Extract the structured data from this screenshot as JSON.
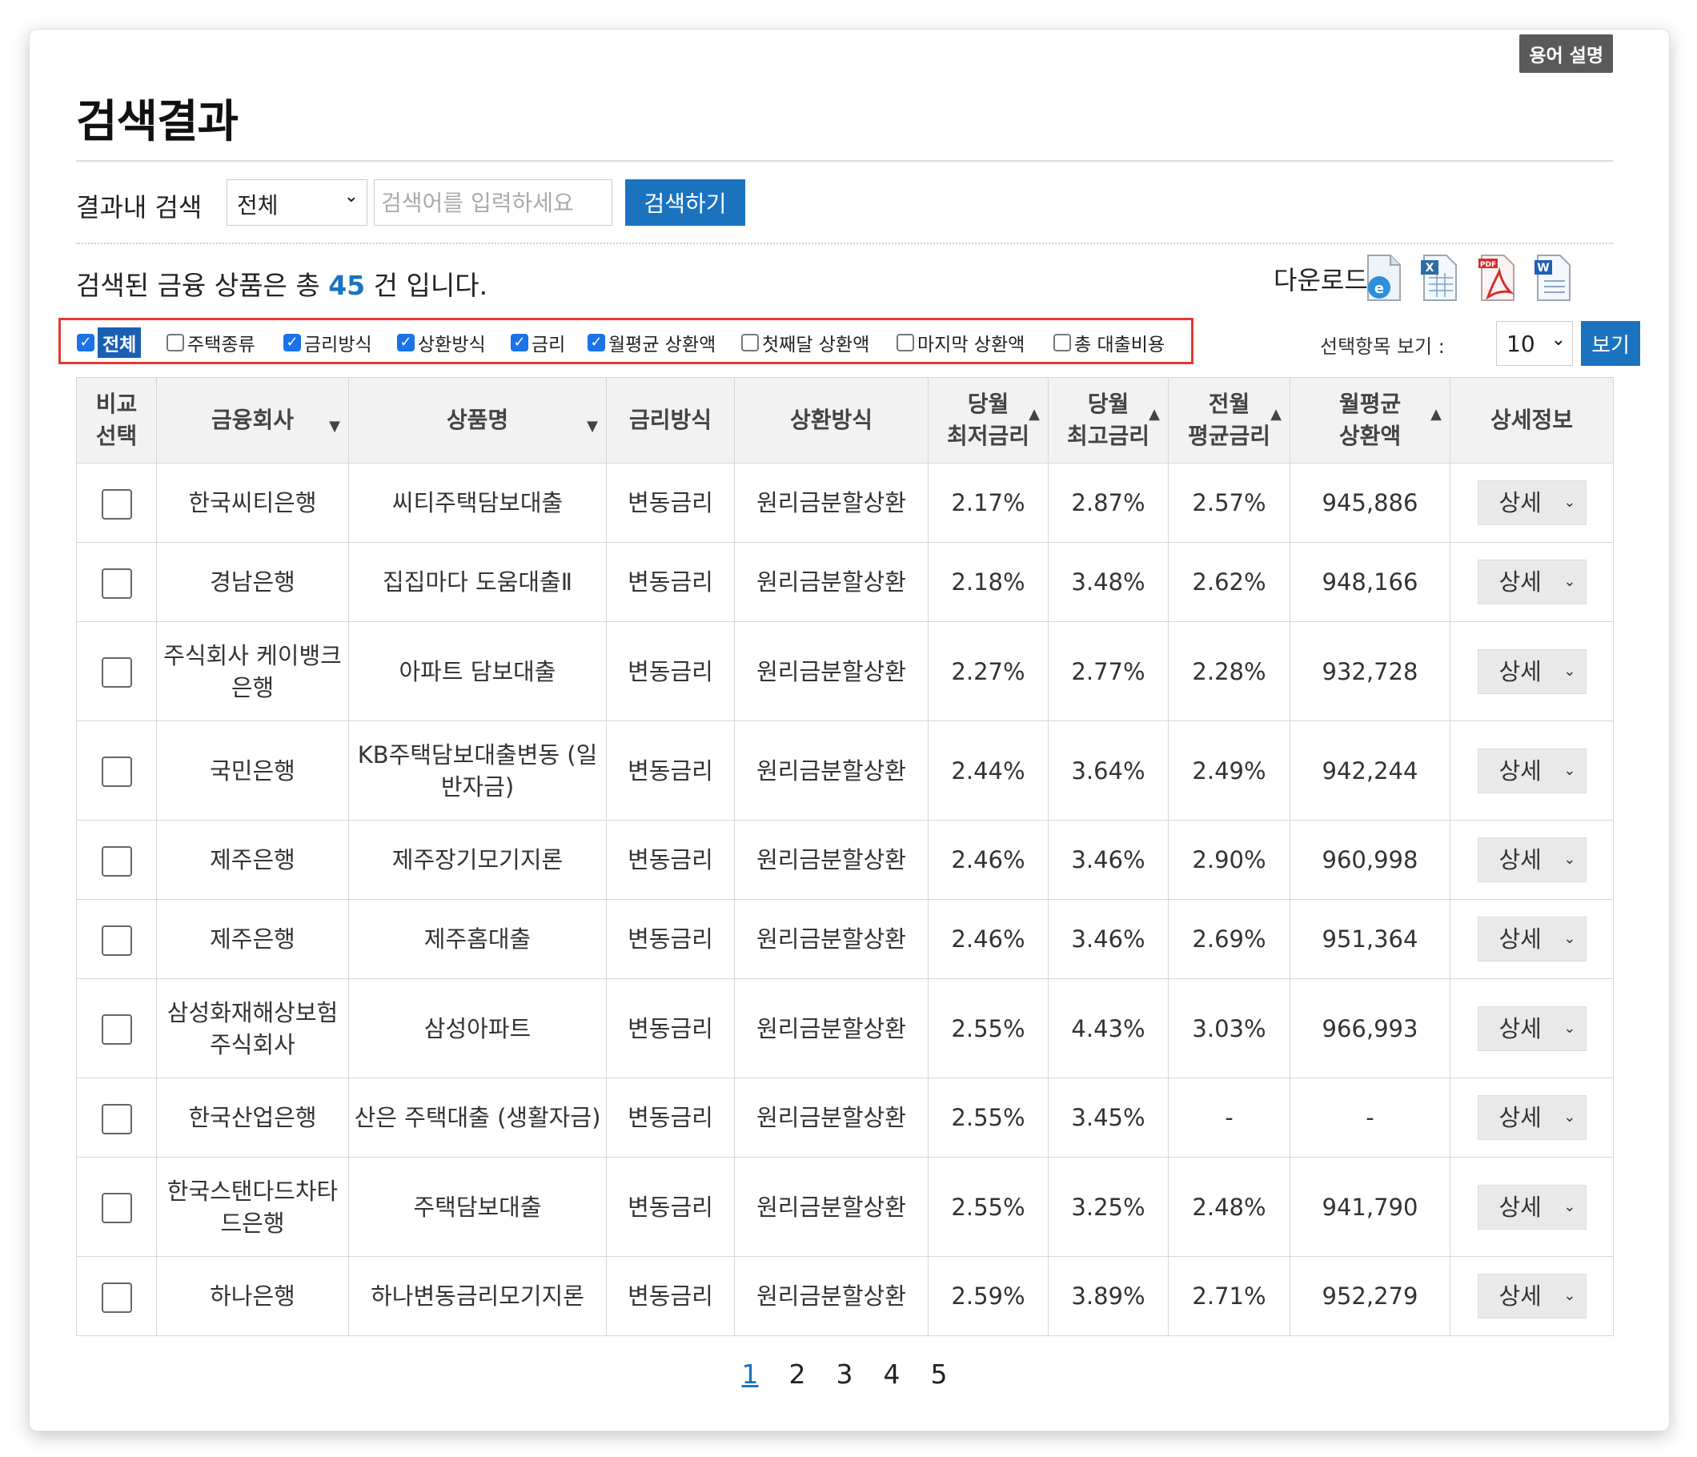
{
  "header": {
    "glossary_button": "용어 설명",
    "title": "검색결과"
  },
  "search": {
    "label": "결과내 검색",
    "scope_value": "전체",
    "placeholder": "검색어를 입력하세요",
    "value": "",
    "button": "검색하기"
  },
  "summary": {
    "prefix": "검색된 금융 상품은 총",
    "count": "45",
    "suffix": "건 입니다."
  },
  "download": {
    "label": "다운로드",
    "formats": [
      "hwp-icon",
      "excel-icon",
      "pdf-icon",
      "word-icon"
    ]
  },
  "column_filters": [
    {
      "label": "전체",
      "checked": true
    },
    {
      "label": "주택종류",
      "checked": false
    },
    {
      "label": "금리방식",
      "checked": true
    },
    {
      "label": "상환방식",
      "checked": true
    },
    {
      "label": "금리",
      "checked": true
    },
    {
      "label": "월평균 상환액",
      "checked": true
    },
    {
      "label": "첫째달 상환액",
      "checked": false
    },
    {
      "label": "마지막 상환액",
      "checked": false
    },
    {
      "label": "총 대출비용",
      "checked": false
    }
  ],
  "view": {
    "label": "선택항목 보기 :",
    "rows_value": "10",
    "button": "보기"
  },
  "table": {
    "headers": {
      "compare_1": "비교",
      "compare_2": "선택",
      "company": "금융회사",
      "product": "상품명",
      "rate_type": "금리방식",
      "repay": "상환방식",
      "min_rate_1": "당월",
      "min_rate_2": "최저금리",
      "max_rate_1": "당월",
      "max_rate_2": "최고금리",
      "avg_rate_1": "전월",
      "avg_rate_2": "평균금리",
      "monthly_1": "월평균",
      "monthly_2": "상환액",
      "detail": "상세정보"
    },
    "detail_button": "상세",
    "rows": [
      {
        "company": "한국씨티은행",
        "product": "씨티주택담보대출",
        "rate_type": "변동금리",
        "repay": "원리금분할상환",
        "min": "2.17%",
        "max": "2.87%",
        "avg": "2.57%",
        "monthly": "945,886"
      },
      {
        "company": "경남은행",
        "product": "집집마다 도움대출Ⅱ",
        "rate_type": "변동금리",
        "repay": "원리금분할상환",
        "min": "2.18%",
        "max": "3.48%",
        "avg": "2.62%",
        "monthly": "948,166"
      },
      {
        "company": "주식회사 케이뱅크은행",
        "product": "아파트 담보대출",
        "rate_type": "변동금리",
        "repay": "원리금분할상환",
        "min": "2.27%",
        "max": "2.77%",
        "avg": "2.28%",
        "monthly": "932,728"
      },
      {
        "company": "국민은행",
        "product": "KB주택담보대출변동 (일반자금)",
        "rate_type": "변동금리",
        "repay": "원리금분할상환",
        "min": "2.44%",
        "max": "3.64%",
        "avg": "2.49%",
        "monthly": "942,244"
      },
      {
        "company": "제주은행",
        "product": "제주장기모기지론",
        "rate_type": "변동금리",
        "repay": "원리금분할상환",
        "min": "2.46%",
        "max": "3.46%",
        "avg": "2.90%",
        "monthly": "960,998"
      },
      {
        "company": "제주은행",
        "product": "제주홈대출",
        "rate_type": "변동금리",
        "repay": "원리금분할상환",
        "min": "2.46%",
        "max": "3.46%",
        "avg": "2.69%",
        "monthly": "951,364"
      },
      {
        "company": "삼성화재해상보험주식회사",
        "product": "삼성아파트",
        "rate_type": "변동금리",
        "repay": "원리금분할상환",
        "min": "2.55%",
        "max": "4.43%",
        "avg": "3.03%",
        "monthly": "966,993"
      },
      {
        "company": "한국산업은행",
        "product": "산은 주택대출 (생활자금)",
        "rate_type": "변동금리",
        "repay": "원리금분할상환",
        "min": "2.55%",
        "max": "3.45%",
        "avg": "-",
        "monthly": "-"
      },
      {
        "company": "한국스탠다드차타드은행",
        "product": "주택담보대출",
        "rate_type": "변동금리",
        "repay": "원리금분할상환",
        "min": "2.55%",
        "max": "3.25%",
        "avg": "2.48%",
        "monthly": "941,790"
      },
      {
        "company": "하나은행",
        "product": "하나변동금리모기지론",
        "rate_type": "변동금리",
        "repay": "원리금분할상환",
        "min": "2.59%",
        "max": "3.89%",
        "avg": "2.71%",
        "monthly": "952,279"
      }
    ]
  },
  "pagination": {
    "pages": [
      "1",
      "2",
      "3",
      "4",
      "5"
    ],
    "current": "1"
  }
}
